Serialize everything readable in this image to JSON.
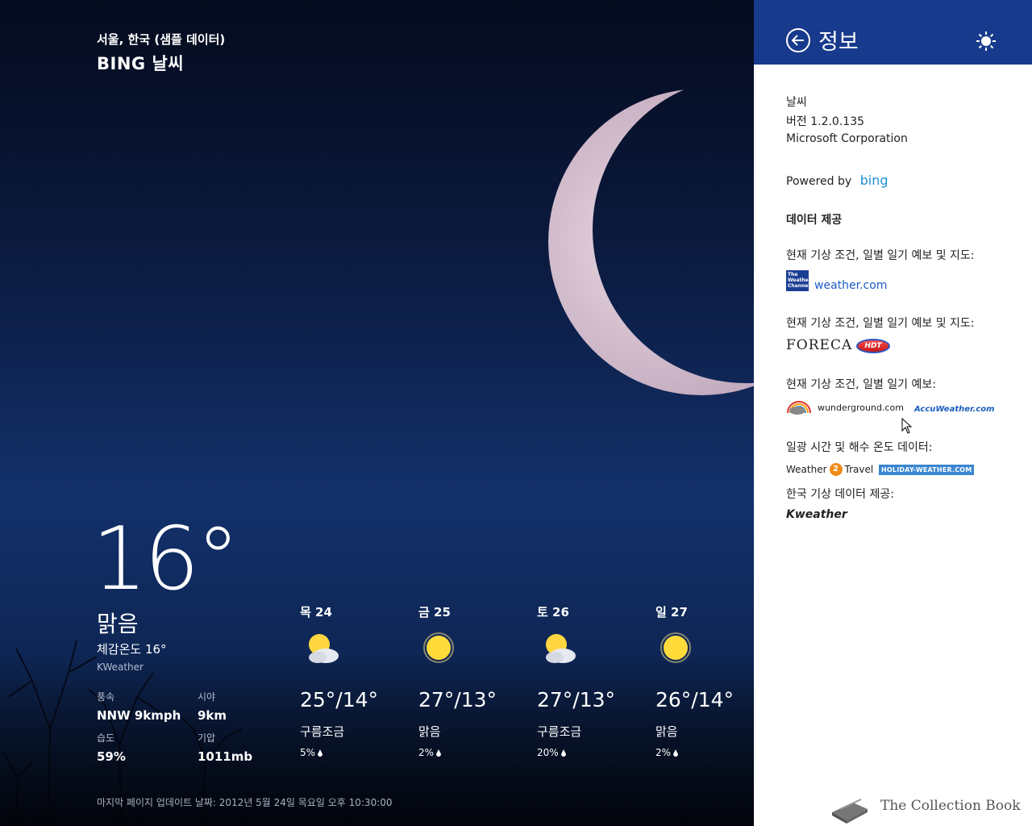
{
  "weather": {
    "location": "서울, 한국 (샘플 데이터)",
    "app_title": "BING 날씨",
    "current": {
      "temp": "16°",
      "condition": "맑음",
      "feels_like": "체감온도 16°",
      "provider": "KWeather",
      "wind_label": "풍속",
      "wind_value": "NNW 9kmph",
      "visibility_label": "시야",
      "visibility_value": "9km",
      "humidity_label": "습도",
      "humidity_value": "59%",
      "pressure_label": "기압",
      "pressure_value": "1011mb"
    },
    "forecast": [
      {
        "day": "목 24",
        "icon": "partly-cloudy-icon",
        "temp": "25°/14°",
        "condition": "구름조금",
        "precip": "5%"
      },
      {
        "day": "금 25",
        "icon": "sunny-icon",
        "temp": "27°/13°",
        "condition": "맑음",
        "precip": "2%"
      },
      {
        "day": "토 26",
        "icon": "partly-cloudy-icon",
        "temp": "27°/13°",
        "condition": "구름조금",
        "precip": "20%"
      },
      {
        "day": "일 27",
        "icon": "sunny-icon",
        "temp": "26°/14°",
        "condition": "맑음",
        "precip": "2%"
      }
    ],
    "updated": "마지막 페이지 업데이트 날짜: 2012년 5월 24일 목요일 오후 10:30:00"
  },
  "flyout": {
    "title": "정보",
    "app_name": "날씨",
    "version": "버전 1.2.0.135",
    "company": "Microsoft Corporation",
    "powered_by": "Powered by",
    "bing": "bing",
    "data_heading": "데이터 제공",
    "section1": "현재 기상 조건, 일별 일기 예보 및 지도:",
    "twc_logo": "The Weather Channel",
    "weather_link": "weather.com",
    "section2": "현재 기상 조건, 일별 일기 예보 및 지도:",
    "foreca": "FORECA",
    "hdt": "HDT",
    "section3": "현재 기상 조건, 일별 일기 예보:",
    "wunderground": "wunderground.com",
    "accuweather": "AccuWeather.com",
    "section4": "일광 시간 및 해수 온도 데이터:",
    "w2t_left": "Weather",
    "w2t_num": "2",
    "w2t_right": "Travel",
    "holiday": "HOLIDAY-WEATHER.COM",
    "section5": "한국 기상 데이터 제공:",
    "kweather": "Kweather"
  },
  "watermark": {
    "text": "The Collection Book"
  },
  "colors": {
    "header": "#183a8c",
    "link": "#1c5bc7"
  }
}
